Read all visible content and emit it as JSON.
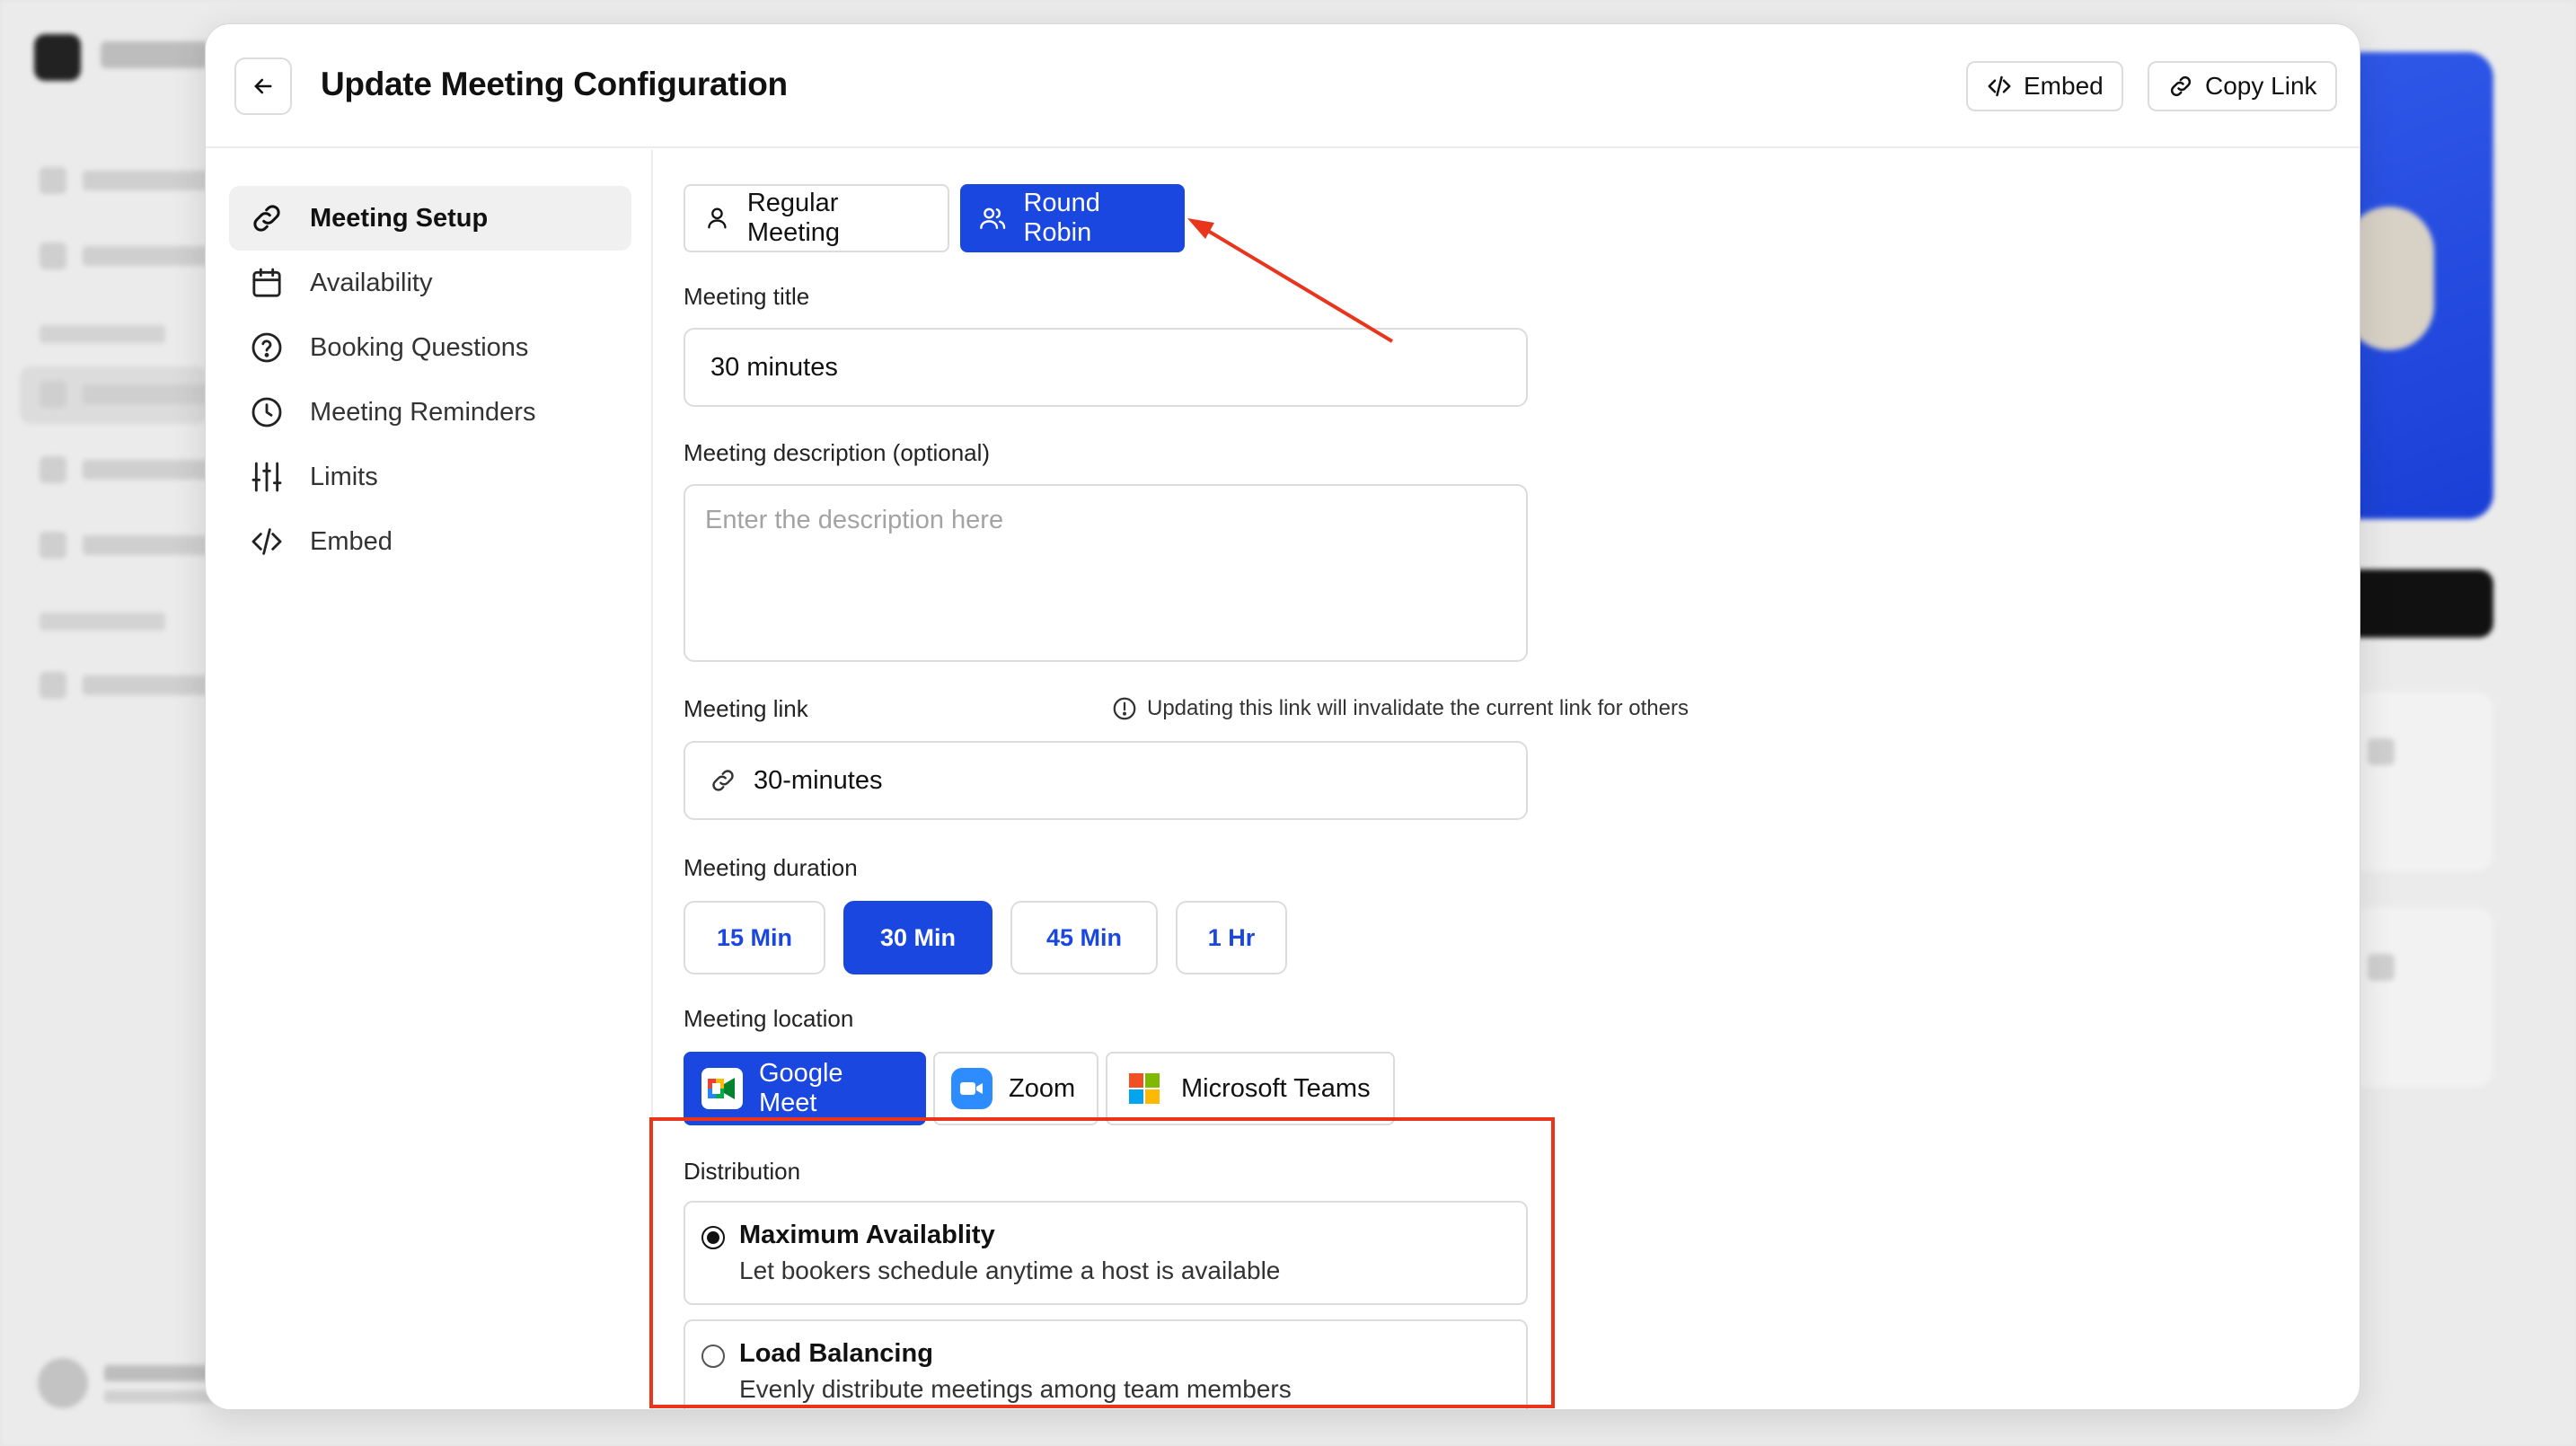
{
  "modal": {
    "title": "Update Meeting Configuration",
    "embed_label": "Embed",
    "copy_link_label": "Copy Link"
  },
  "sidebar": {
    "items": [
      {
        "label": "Meeting Setup",
        "icon": "link-icon",
        "active": true
      },
      {
        "label": "Availability",
        "icon": "calendar-icon"
      },
      {
        "label": "Booking Questions",
        "icon": "question-circle-icon"
      },
      {
        "label": "Meeting Reminders",
        "icon": "clock-icon"
      },
      {
        "label": "Limits",
        "icon": "sliders-icon"
      },
      {
        "label": "Embed",
        "icon": "code-icon"
      }
    ]
  },
  "meeting_type": {
    "regular_label": "Regular Meeting",
    "round_robin_label": "Round Robin",
    "selected": "Round Robin"
  },
  "form": {
    "title_label": "Meeting title",
    "title_value": "30 minutes",
    "description_label": "Meeting description (optional)",
    "description_placeholder": "Enter the description here",
    "link_label": "Meeting link",
    "link_note": "Updating this link will invalidate the current link for others",
    "link_value": "30-minutes",
    "duration_label": "Meeting duration",
    "durations": [
      "15 Min",
      "30 Min",
      "45 Min",
      "1 Hr"
    ],
    "duration_selected": "30 Min",
    "location_label": "Meeting location",
    "locations": [
      "Google Meet",
      "Zoom",
      "Microsoft Teams"
    ],
    "location_selected": "Google Meet",
    "distribution_label": "Distribution",
    "distribution_options": [
      {
        "title": "Maximum Availablity",
        "description": "Let bookers schedule anytime a host is available",
        "selected": true
      },
      {
        "title": "Load Balancing",
        "description": "Evenly distribute meetings among team members",
        "selected": false
      }
    ]
  },
  "colors": {
    "accent": "#1a47e0",
    "annotation": "#e8351c"
  }
}
